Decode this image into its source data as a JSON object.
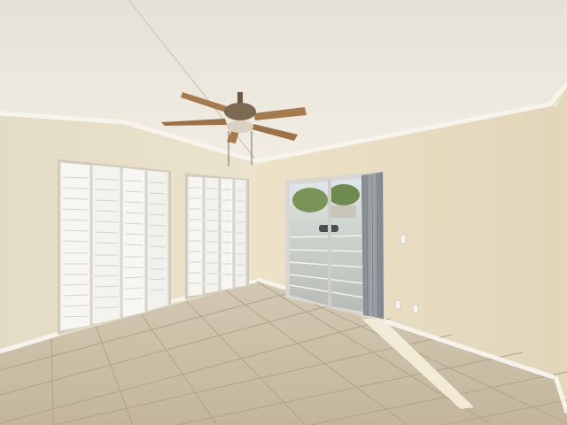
{
  "scene": {
    "subject": "empty-bedroom-interior",
    "colors": {
      "ceiling": "#eeeae0",
      "ceiling_shadow": "#d8d2c4",
      "wall_left": "#e7dfc8",
      "wall_back": "#ece4cc",
      "wall_right": "#e8dcc0",
      "trim": "#f6f3ec",
      "closet_door": "#f7f6f2",
      "louver_line": "#d9d7d0",
      "floor_tile": "#cbbfa9",
      "grout": "#b3a78f",
      "fan_blade": "#a57a4f",
      "fan_metal": "#6a5a44",
      "curtain": "#8f9599",
      "door_frame": "#d9d7d2",
      "sky": "#dfe7ee",
      "tree": "#6e8a4e",
      "sun_patch": "#f6efdc"
    },
    "fixtures": {
      "ceiling_fan": "ceiling-fan-five-blade",
      "closets": [
        "bifold-louvered-closet-left",
        "bifold-louvered-closet-right"
      ],
      "door": "sliding-glass-door",
      "window_covering": "vertical-blind-curtain"
    }
  }
}
